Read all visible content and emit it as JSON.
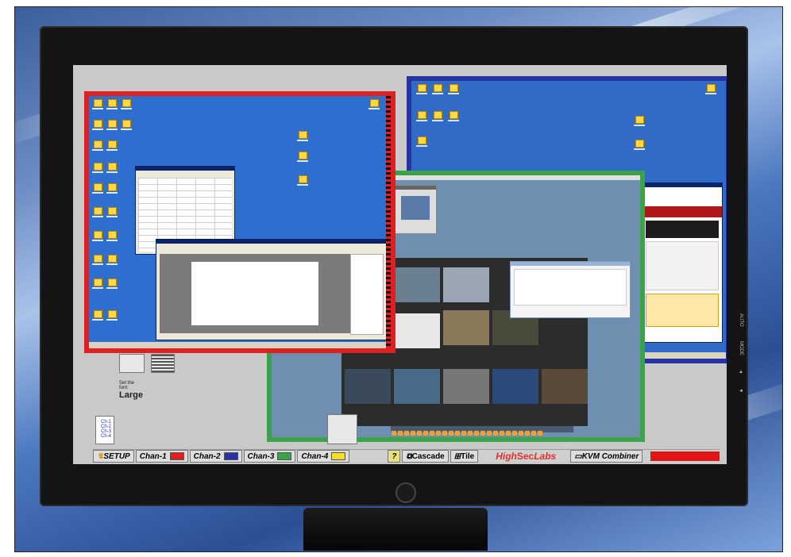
{
  "toolbar": {
    "setup": "SETUP",
    "channels": [
      {
        "label": "Chan-1",
        "color": "#e02020"
      },
      {
        "label": "Chan-2",
        "color": "#2733a3"
      },
      {
        "label": "Chan-3",
        "color": "#3aa34a"
      },
      {
        "label": "Chan-4",
        "color": "#f2e020"
      }
    ],
    "cascade": "Cascade",
    "tile": "Tile",
    "brand_high": "High",
    "brand_sec": "Sec",
    "brand_labs": "Labs",
    "combiner": "KVM Combiner"
  },
  "panel": {
    "text_size_label": "Large",
    "system_items": [
      "Ch-1",
      "Ch-2",
      "Ch-3",
      "Ch-4"
    ],
    "small_notes": [
      "Set the",
      "font:"
    ]
  },
  "colors": {
    "channel_1": "#e02020",
    "channel_2": "#2733a3",
    "channel_3": "#3aa34a",
    "channel_4": "#f2e020"
  },
  "icons": [
    "setup-icon",
    "cascade-icon",
    "tile-icon",
    "kvm-combiner-icon",
    "help-icon"
  ]
}
